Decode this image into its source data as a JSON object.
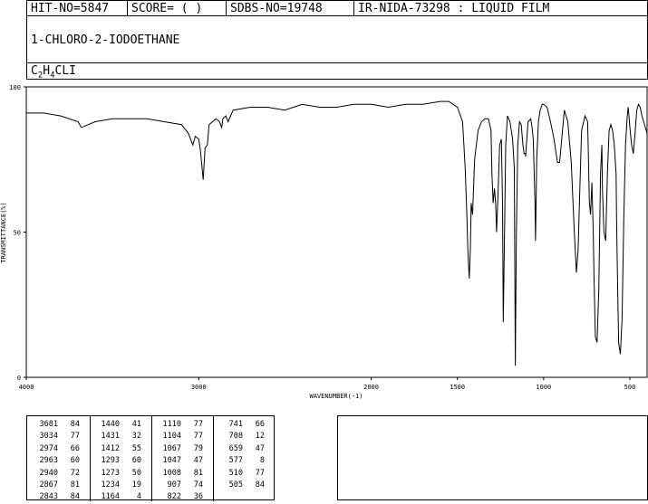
{
  "header": {
    "hit_no": "HIT-NO=5847",
    "score": "SCORE=  (  )",
    "sdbs_no": "SDBS-NO=19748",
    "ir_nida": "IR-NIDA-73298 : LIQUID FILM"
  },
  "compound": {
    "name": "1-CHLORO-2-IODOETHANE",
    "formula_parts": [
      "C",
      "2",
      "H",
      "4",
      "CLI"
    ]
  },
  "chart_data": {
    "type": "line",
    "xlabel": "WAVENUMBER(-1)",
    "ylabel": "TRANSMITTANCE(%)",
    "xlim": [
      4000,
      400
    ],
    "ylim": [
      0,
      100
    ],
    "x_ticks": [
      4000,
      3000,
      2000,
      1500,
      1000,
      500
    ],
    "y_ticks": [
      0,
      50,
      100
    ],
    "grid": false,
    "x": [
      4000,
      3900,
      3800,
      3700,
      3681,
      3600,
      3500,
      3400,
      3300,
      3200,
      3100,
      3060,
      3034,
      3020,
      3000,
      2990,
      2974,
      2963,
      2950,
      2940,
      2920,
      2900,
      2880,
      2867,
      2860,
      2843,
      2830,
      2800,
      2700,
      2600,
      2500,
      2400,
      2300,
      2200,
      2100,
      2000,
      1900,
      1800,
      1700,
      1600,
      1550,
      1500,
      1470,
      1455,
      1445,
      1440,
      1435,
      1431,
      1425,
      1420,
      1412,
      1400,
      1380,
      1360,
      1340,
      1320,
      1305,
      1300,
      1293,
      1285,
      1278,
      1273,
      1265,
      1255,
      1245,
      1238,
      1234,
      1228,
      1220,
      1210,
      1195,
      1180,
      1170,
      1164,
      1158,
      1150,
      1140,
      1130,
      1120,
      1113,
      1110,
      1106,
      1104,
      1100,
      1090,
      1075,
      1067,
      1060,
      1050,
      1047,
      1040,
      1030,
      1020,
      1008,
      1000,
      980,
      960,
      940,
      920,
      907,
      895,
      880,
      860,
      840,
      822,
      810,
      800,
      790,
      780,
      760,
      745,
      741,
      735,
      728,
      720,
      712,
      708,
      700,
      690,
      680,
      670,
      662,
      659,
      650,
      640,
      630,
      620,
      610,
      600,
      590,
      580,
      577,
      572,
      565,
      555,
      545,
      535,
      525,
      515,
      510,
      505,
      500,
      490,
      480,
      470,
      460,
      450,
      440,
      430,
      420,
      410,
      400
    ],
    "y": [
      91,
      91,
      90,
      88,
      86,
      88,
      89,
      89,
      89,
      88,
      87,
      84,
      80,
      83,
      82,
      78,
      68,
      79,
      80,
      87,
      88,
      89,
      88,
      86,
      89,
      90,
      88,
      92,
      93,
      93,
      92,
      94,
      93,
      93,
      94,
      94,
      93,
      94,
      94,
      95,
      95,
      93,
      88,
      72,
      55,
      45,
      38,
      34,
      44,
      60,
      56,
      75,
      85,
      88,
      89,
      89,
      85,
      70,
      60,
      65,
      60,
      50,
      62,
      80,
      82,
      60,
      19,
      45,
      80,
      90,
      88,
      82,
      72,
      4,
      50,
      80,
      88,
      87,
      80,
      77,
      77,
      77,
      76,
      80,
      88,
      89,
      86,
      82,
      60,
      47,
      75,
      88,
      92,
      94,
      94,
      93,
      88,
      82,
      74,
      74,
      82,
      92,
      88,
      74,
      50,
      36,
      44,
      65,
      85,
      90,
      88,
      78,
      60,
      56,
      67,
      50,
      35,
      14,
      12,
      30,
      70,
      80,
      65,
      50,
      47,
      70,
      85,
      87,
      85,
      80,
      70,
      55,
      35,
      12,
      8,
      20,
      55,
      80,
      90,
      93,
      90,
      86,
      80,
      77,
      84,
      92,
      94,
      93,
      90,
      88,
      86,
      84,
      82,
      80,
      79,
      78
    ]
  },
  "peaks": [
    [
      "3681",
      "84"
    ],
    [
      "3034",
      "77"
    ],
    [
      "2974",
      "66"
    ],
    [
      "2963",
      "60"
    ],
    [
      "2940",
      "72"
    ],
    [
      "2867",
      "81"
    ],
    [
      "2843",
      "84"
    ],
    [
      "1440",
      "41"
    ],
    [
      "1431",
      "32"
    ],
    [
      "1412",
      "55"
    ],
    [
      "1293",
      "60"
    ],
    [
      "1273",
      "50"
    ],
    [
      "1234",
      "19"
    ],
    [
      "1164",
      "4"
    ],
    [
      "1110",
      "77"
    ],
    [
      "1104",
      "77"
    ],
    [
      "1067",
      "79"
    ],
    [
      "1047",
      "47"
    ],
    [
      "1008",
      "81"
    ],
    [
      "907",
      "74"
    ],
    [
      "822",
      "36"
    ],
    [
      "741",
      "66"
    ],
    [
      "708",
      "12"
    ],
    [
      "659",
      "47"
    ],
    [
      "577",
      "8"
    ],
    [
      "510",
      "77"
    ],
    [
      "505",
      "84"
    ]
  ]
}
